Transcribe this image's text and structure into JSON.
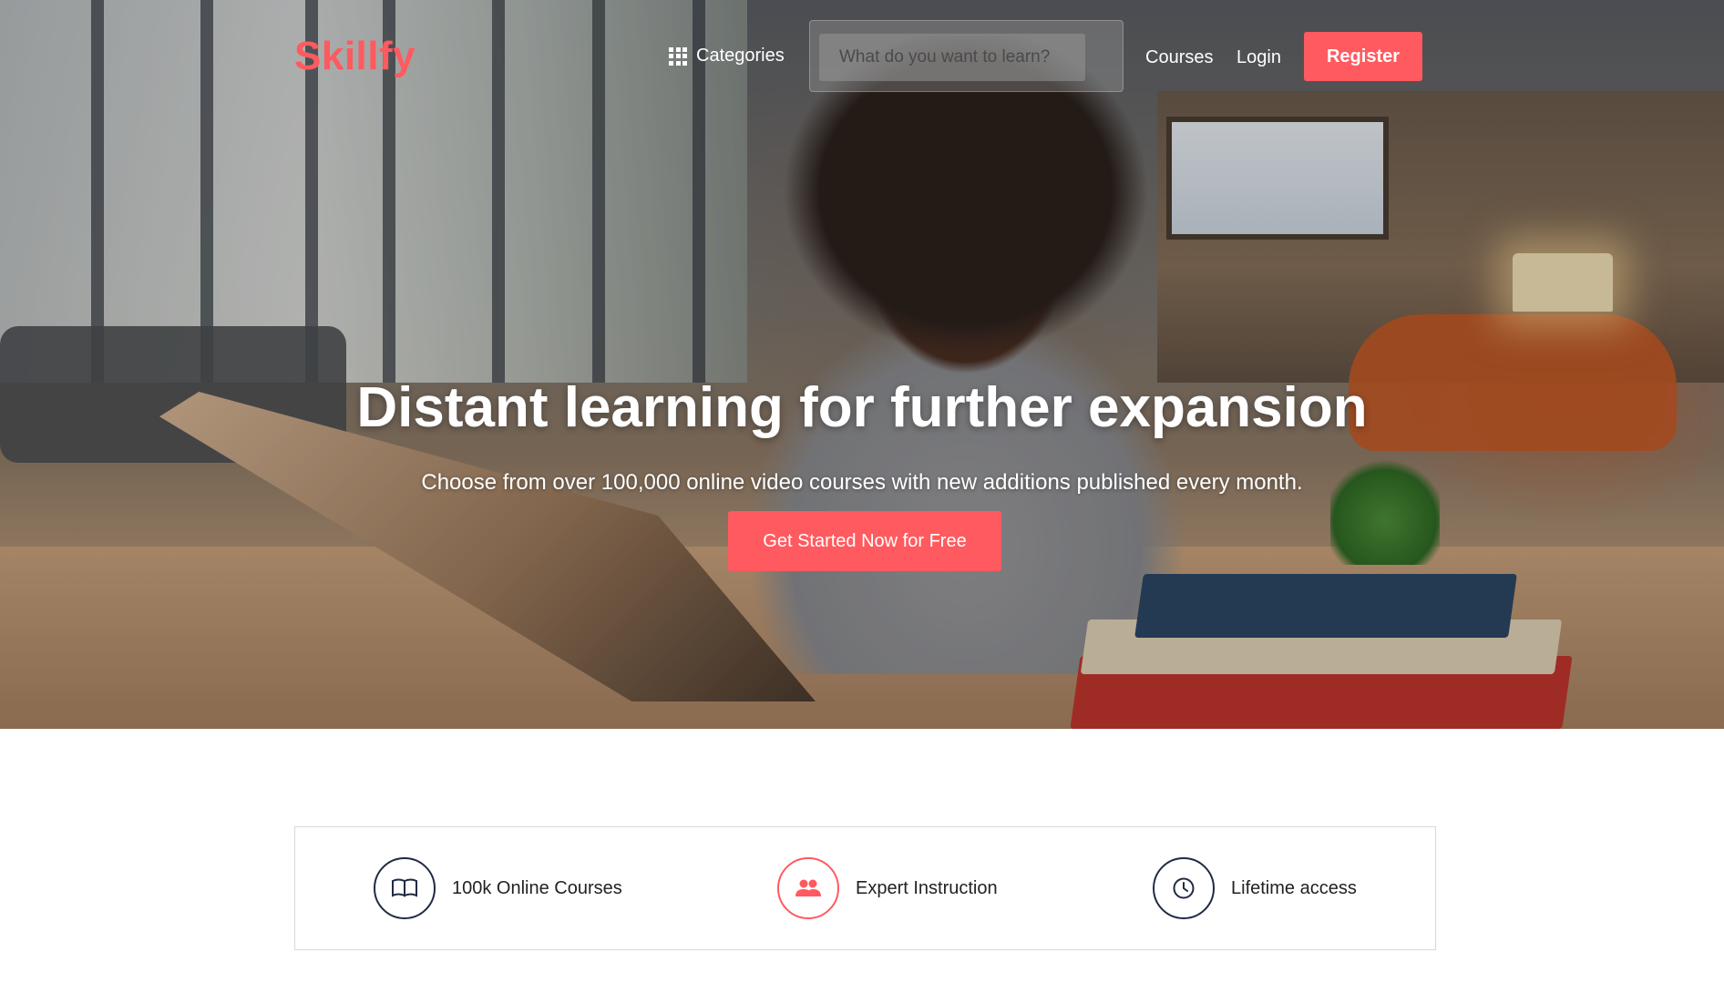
{
  "brand": {
    "logo": "Skillfy",
    "accent": "#ff5a5f",
    "dark": "#1f2a44"
  },
  "nav": {
    "categories_label": "Categories",
    "categories_icon": "grid-icon",
    "search_placeholder": "What do you want to learn?",
    "courses_label": "Courses",
    "login_label": "Login",
    "register_label": "Register"
  },
  "hero": {
    "title": "Distant learning for further expansion",
    "subtitle": "Choose from over 100,000 online video courses with new additions published every month.",
    "cta_label": "Get Started Now for Free"
  },
  "features": [
    {
      "icon": "book-icon",
      "label": "100k Online Courses"
    },
    {
      "icon": "users-icon",
      "label": "Expert Instruction"
    },
    {
      "icon": "clock-icon",
      "label": "Lifetime access"
    }
  ]
}
